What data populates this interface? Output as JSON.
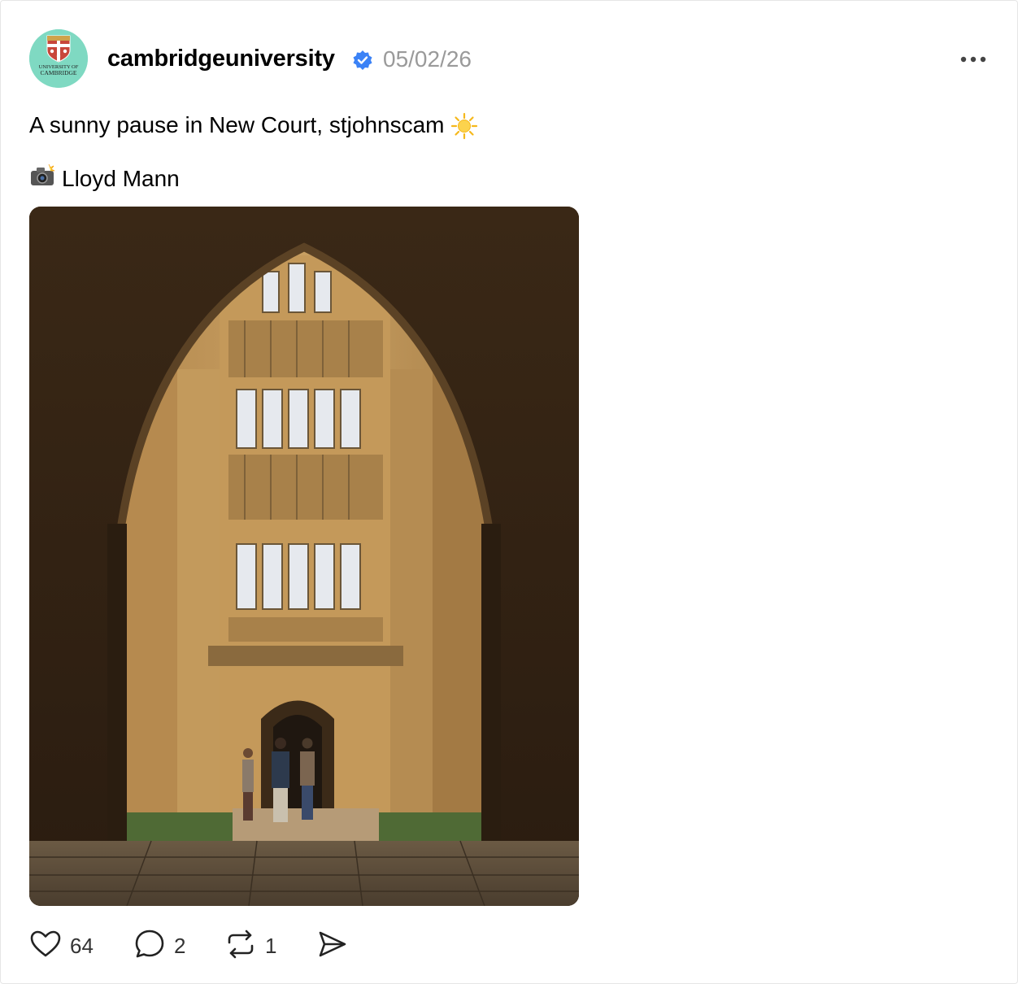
{
  "post": {
    "username": "cambridgeuniversity",
    "timestamp": "05/02/26",
    "caption": "A sunny pause in New Court, stjohnscam",
    "caption_emoji": "sun-icon",
    "credit": "Lloyd Mann",
    "credit_emoji": "camera-flash-icon",
    "avatar": {
      "line1": "UNIVERSITY OF",
      "line2": "CAMBRIDGE",
      "background": "#7fd9c2"
    },
    "verified_color": "#3b82f6",
    "image_alt": "Gothic stone archway framing New Court tower with people standing at the entrance"
  },
  "actions": {
    "likes": "64",
    "replies": "2",
    "reposts": "1"
  },
  "icons": [
    "heart-icon",
    "comment-icon",
    "repost-icon",
    "share-icon",
    "more-icon",
    "verified-icon"
  ]
}
